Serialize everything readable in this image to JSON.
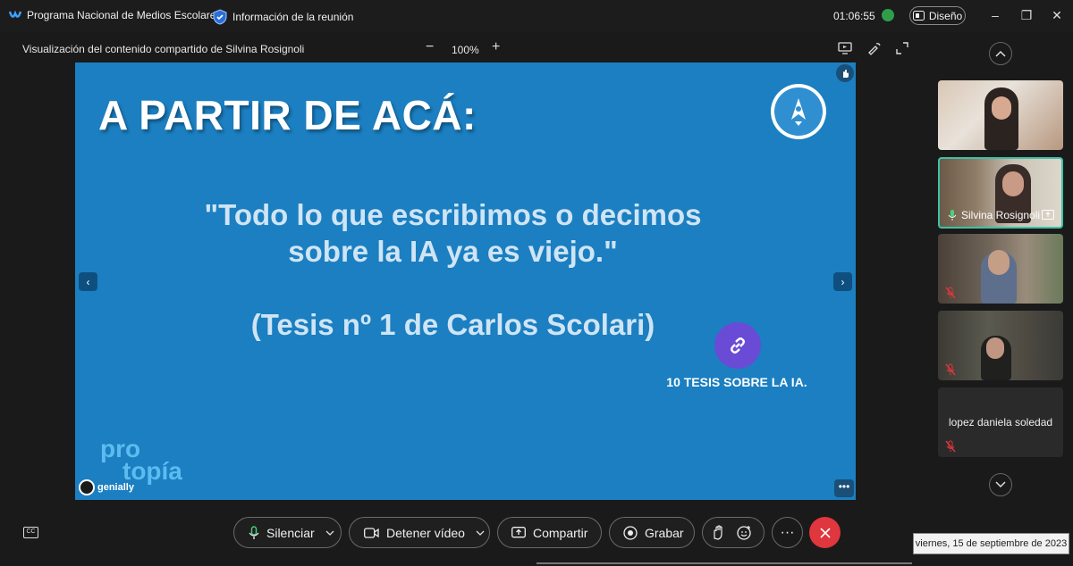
{
  "titlebar": {
    "app_name": "Programa Nacional de Medios Escolares",
    "meeting_info": "Información de la reunión",
    "clock": "01:06:55",
    "design_label": "Diseño"
  },
  "share_bar": {
    "title": "Visualización del contenido compartido de Silvina Rosignoli",
    "zoom_minus": "−",
    "zoom_level": "100%",
    "zoom_plus": "+"
  },
  "slide": {
    "heading": "A PARTIR  DE ACÁ:",
    "quote_line1": "\"Todo lo que escribimos o decimos",
    "quote_line2": "sobre la IA ya es viejo.\"",
    "thesis": "(Tesis nº 1 de Carlos Scolari)",
    "link_label": "10 TESIS SOBRE LA IA.",
    "brand_line1": "pro",
    "brand_line2": "topía",
    "genially": "genially",
    "more": "•••",
    "prev": "‹",
    "next": "›"
  },
  "participants": [
    {
      "name": "",
      "muted": false
    },
    {
      "name": "Silvina Rosignoli",
      "muted": false,
      "active": true
    },
    {
      "name": "",
      "muted": true
    },
    {
      "name": "",
      "muted": true
    },
    {
      "name": "lopez daniela soledad",
      "muted": true
    }
  ],
  "toolbar": {
    "mute_label": "Silenciar",
    "video_label": "Detener vídeo",
    "share_label": "Compartir",
    "record_label": "Grabar",
    "more": "···"
  },
  "tooltip": {
    "date": "viernes, 15 de septiembre de 2023"
  },
  "colors": {
    "slide_bg": "#1b7fc1",
    "leave": "#e0363e",
    "active_border": "#3fc1a8",
    "link_circle": "#6a4bd6"
  }
}
